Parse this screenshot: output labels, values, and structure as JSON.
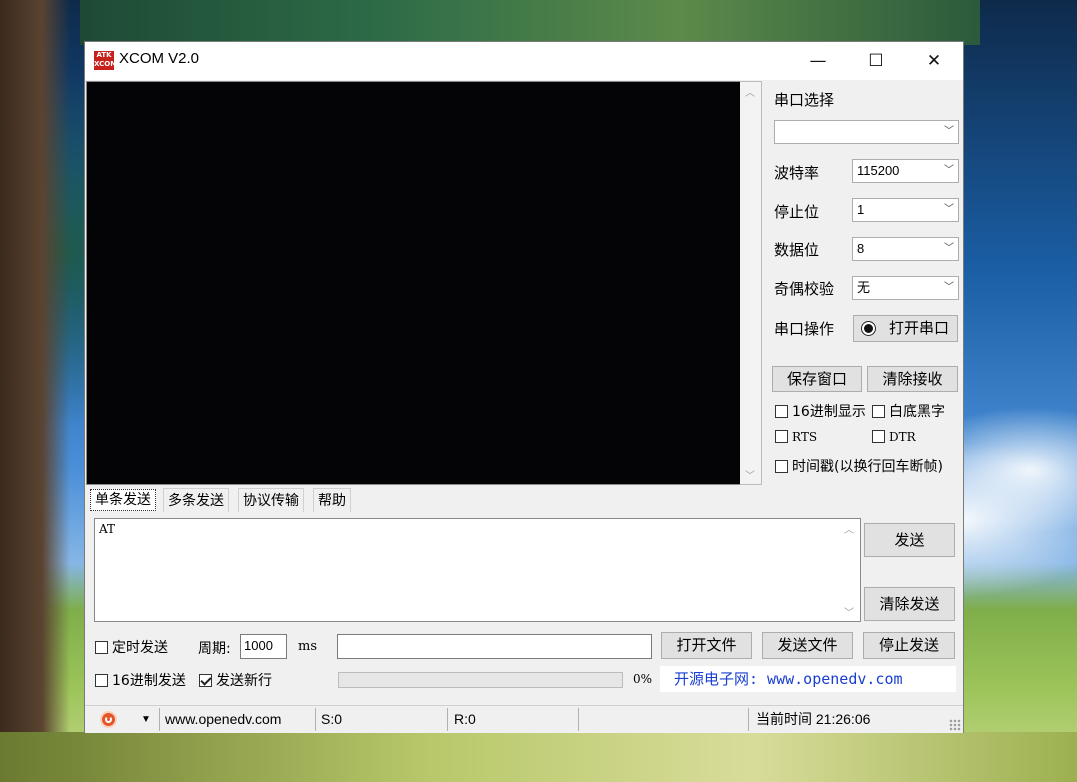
{
  "window": {
    "title": "XCOM V2.0",
    "app_icon_text": "ATK\nXCOM",
    "minimize_glyph": "—",
    "maximize_glyph": "☐",
    "close_glyph": "✕"
  },
  "receive_area": {
    "text": ""
  },
  "serial": {
    "port_select_label": "串口选择",
    "port_value": "",
    "baud_label": "波特率",
    "baud_value": "115200",
    "stop_bits_label": "停止位",
    "stop_bits_value": "1",
    "data_bits_label": "数据位",
    "data_bits_value": "8",
    "parity_label": "奇偶校验",
    "parity_value": "无",
    "operation_label": "串口操作",
    "open_port_label": "打开串口"
  },
  "receive_options": {
    "save_window_label": "保存窗口",
    "clear_receive_label": "清除接收",
    "hex_display_label": "16进制显示",
    "hex_display_checked": false,
    "white_bg_label": "白底黑字",
    "white_bg_checked": false,
    "rts_label": "RTS",
    "rts_checked": false,
    "dtr_label": "DTR",
    "dtr_checked": false,
    "timestamp_label": "时间戳(以换行回车断帧)",
    "timestamp_checked": false
  },
  "tabs": [
    {
      "label": "单条发送",
      "active": true
    },
    {
      "label": "多条发送",
      "active": false
    },
    {
      "label": "协议传输",
      "active": false
    },
    {
      "label": "帮助",
      "active": false
    }
  ],
  "send": {
    "text": "AT",
    "send_label": "发送",
    "clear_send_label": "清除发送",
    "timed_send_label": "定时发送",
    "timed_send_checked": false,
    "period_label": "周期:",
    "period_value": "1000",
    "period_unit": "ms",
    "file_path": "",
    "open_file_label": "打开文件",
    "send_file_label": "发送文件",
    "stop_send_label": "停止发送",
    "hex_send_label": "16进制发送",
    "hex_send_checked": false,
    "newline_label": "发送新行",
    "newline_checked": true,
    "progress_value": 0,
    "progress_text": "0%",
    "ad_text": "开源电子网: www.openedv.com"
  },
  "statusbar": {
    "dropdown_glyph": "▼",
    "website": "www.openedv.com",
    "sent": "S:0",
    "received": "R:0",
    "current_time": "当前时间 21:26:06"
  },
  "colors": {
    "receive_bg": "#040306",
    "ad_text": "#1a3fd0",
    "progress_fill": "#06b025"
  }
}
